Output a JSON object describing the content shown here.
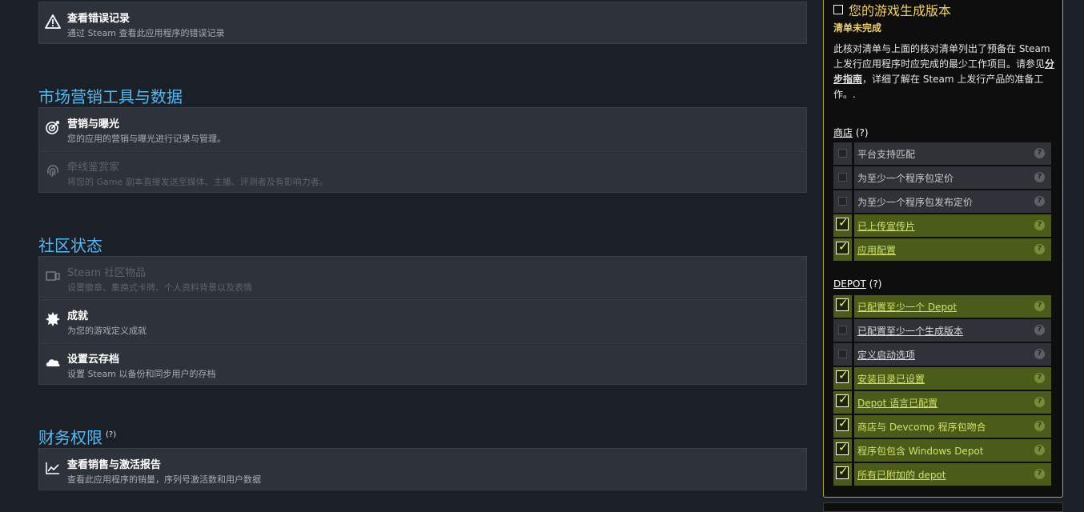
{
  "sections": {
    "top_item": {
      "title": "查看错误记录",
      "desc": "通过 Steam 查看此应用程序的错误记录",
      "icon": "warning-icon"
    },
    "marketing": {
      "title": "市场营销工具与数据",
      "items": [
        {
          "title": "营销与曝光",
          "desc": "您的应用的营销与曝光进行记录与管理。",
          "icon": "target-icon"
        },
        {
          "title": "牵线鉴赏家",
          "desc": "将您的 Game 副本直接发送至媒体、主播、评测者及有影响力者。",
          "icon": "fingerprint-icon"
        }
      ]
    },
    "community": {
      "title": "社区状态",
      "items": [
        {
          "title": "Steam 社区物品",
          "desc": "设置徽章、集换式卡牌、个人资料背景以及表情",
          "icon": "devices-icon"
        },
        {
          "title": "成就",
          "desc": "为您的游戏定义成就",
          "icon": "badge-icon"
        },
        {
          "title": "设置云存档",
          "desc": "设置 Steam 以备份和同步用户的存档",
          "icon": "cloud-icon"
        }
      ]
    },
    "finance": {
      "title": "财务权限",
      "sup": "(?)",
      "items": [
        {
          "title": "查看销售与激活报告",
          "desc": "查看此应用程序的销量，序列号激活数和用户数据",
          "icon": "chart-icon"
        }
      ]
    }
  },
  "checklist": {
    "title": "您的游戏生成版本",
    "status": "清单未完成",
    "desc_prefix": "此核对清单与上面的核对清单列出了预备在 Steam 上发行应用程序时应完成的最少工作项目。请参见",
    "desc_link": "分步指南",
    "desc_suffix": "，详细了解在 Steam 上发行产品的准备工作。.",
    "store": {
      "title": "商店",
      "hint": "(?)",
      "rows": [
        {
          "label": "平台支持匹配",
          "done": false
        },
        {
          "label": "为至少一个程序包定价",
          "done": false
        },
        {
          "label": "为至少一个程序包发布定价",
          "done": false
        },
        {
          "label": "已上传宣传片",
          "done": true
        },
        {
          "label": "应用配置",
          "done": true
        }
      ]
    },
    "depot": {
      "title": "DEPOT",
      "hint": "(?)",
      "rows": [
        {
          "label": "已配置至少一个 Depot",
          "done": true
        },
        {
          "label": "已配置至少一个生成版本",
          "done": false
        },
        {
          "label": "定义启动选项",
          "done": false
        },
        {
          "label": "安装目录已设置",
          "done": true
        },
        {
          "label": "Depot 语言已配置",
          "done": true
        },
        {
          "label": "商店与 Devcomp 程序包吻合",
          "done": true
        },
        {
          "label": "程序包包含 Windows Depot",
          "done": true
        },
        {
          "label": "所有已附加的 depot",
          "done": true
        }
      ]
    },
    "help": "?"
  }
}
